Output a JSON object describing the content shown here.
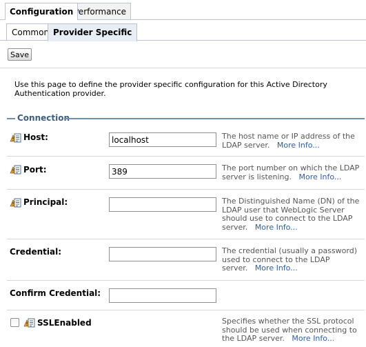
{
  "tabs_top": [
    {
      "label": "Configuration",
      "active": true
    },
    {
      "label": "Performance",
      "active": false
    }
  ],
  "tabs_sub": [
    {
      "label": "Common",
      "active": false
    },
    {
      "label": "Provider Specific",
      "active": true
    }
  ],
  "save_label": "Save",
  "description": "Use this page to define the provider specific configuration for this Active Directory Authentication provider.",
  "section_title": "Connection",
  "icon": "config-change-restart-icon",
  "colors": {
    "section_rule": "#6f8fb0",
    "link": "#2a5fa8",
    "tab_border": "#b8c4d2"
  },
  "more_info_label": "More Info...",
  "fields": {
    "host": {
      "label": "Host:",
      "value": "localhost",
      "help": "The host name or IP address of the LDAP server.",
      "more": "More Info..."
    },
    "port": {
      "label": "Port:",
      "value": "389",
      "help": "The port number on which the LDAP server is listening.",
      "more": "More Info..."
    },
    "principal": {
      "label": "Principal:",
      "value": "",
      "help": "The Distinguished Name (DN) of the LDAP user that WebLogic Server should use to connect to the LDAP server.",
      "more": "More Info..."
    },
    "credential": {
      "label": "Credential:",
      "value": "",
      "help": "The credential (usually a password) used to connect to the LDAP server.",
      "more": "More Info..."
    },
    "confirm_credential": {
      "label": "Confirm Credential:",
      "value": ""
    },
    "ssl_enabled": {
      "label": "SSLEnabled",
      "checked": false,
      "help": "Specifies whether the SSL protocol should be used when connecting to the LDAP server.",
      "more": "More Info..."
    }
  }
}
